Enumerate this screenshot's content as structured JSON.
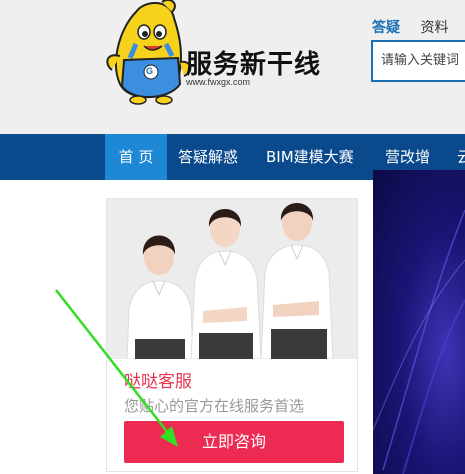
{
  "header": {
    "logo_text": "服务新干线",
    "logo_url": "www.fwxgx.com",
    "logo_badge": "G"
  },
  "search": {
    "tabs": [
      {
        "label": "答疑",
        "active": true
      },
      {
        "label": "资料",
        "active": false
      }
    ],
    "placeholder": "请输入关键词"
  },
  "nav": {
    "items": [
      {
        "label": "首 页",
        "active": true
      },
      {
        "label": "答疑解惑",
        "active": false
      },
      {
        "label": "BIM建模大赛",
        "active": false
      },
      {
        "label": "营改增",
        "active": false
      },
      {
        "label": "云",
        "active": false
      }
    ]
  },
  "service_card": {
    "title": "哒哒客服",
    "subtitle": "您贴心的官方在线服务首选",
    "button_label": "立即咨询"
  },
  "colors": {
    "nav_bg": "#0a4a8c",
    "nav_active": "#1e87d6",
    "accent_red": "#ec2a52",
    "title_red": "#e8344f",
    "link_blue": "#1a6fb6",
    "annotation_arrow": "#33dd22"
  }
}
